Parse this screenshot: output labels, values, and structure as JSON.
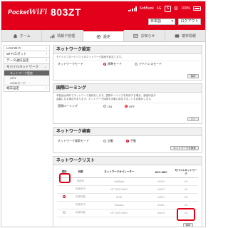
{
  "header": {
    "logo_text": "Pocket",
    "logo_wifi": "WiFi",
    "model": "803ZT",
    "carrier": "SoftBank",
    "network": "4G",
    "s_badge": "S",
    "battery": "100%",
    "language": "日本語",
    "logout": "ログアウト"
  },
  "nav": {
    "items": [
      {
        "label": "ホーム",
        "icon": "home-icon"
      },
      {
        "label": "情報や管理",
        "icon": "data-icon"
      },
      {
        "label": "設定",
        "icon": "gear-icon"
      },
      {
        "label": "お知らせ",
        "icon": "mail-icon"
      },
      {
        "label": "端末情報",
        "icon": "device-icon"
      }
    ],
    "active_index": 2
  },
  "sidebar": {
    "items": [
      {
        "label": "LAN Wi-Fi"
      },
      {
        "label": "Wi-Fiスポット"
      },
      {
        "label": "データ通信設定"
      },
      {
        "label": "モバイルネットワーク"
      }
    ],
    "sub_items": [
      "ネットワーク設定",
      "APN",
      "USIMカード"
    ],
    "after": [
      {
        "label": "端末設定"
      }
    ]
  },
  "network_settings": {
    "title": "ネットワーク設定",
    "desc": "モバイルブロードバンドのネットワーク接続を設定します。",
    "row_label": "ネットワークモード",
    "opt1": "標準モード",
    "opt2": "アドバンスモード",
    "save": "保存"
  },
  "roaming": {
    "title": "国際ローミング",
    "desc1": "本製品は海外でネットワーク接続をします。国際ローミングを利用する場合、通信料金が",
    "desc2": "高額になる場合があります。ネットワーク接続を手動に設定することをお勧めします。",
    "row_label": "国際ローミング",
    "opt_on": "ON",
    "opt_off": "OFF",
    "save": "保存"
  },
  "network_search": {
    "title": "ネットワーク検索",
    "row_label": "ネットワーク検索モード",
    "opt_auto": "自動",
    "opt_manual": "手動",
    "search_button": "ネットワークを検索"
  },
  "network_list": {
    "title": "ネットワークリスト",
    "headers": [
      "選択",
      "状態",
      "ネットワークオペレーター",
      "MCC-MNC",
      "モバイルネットワーク"
    ],
    "rows": [
      {
        "status": "利用中",
        "operator": "SoftBank",
        "mcc": "44020",
        "type": "4G"
      },
      {
        "status": "利用不可",
        "operator": "NTT DOCOMO",
        "mcc": "44010",
        "type": "4G"
      },
      {
        "status": "利用可能",
        "operator": "KDDI",
        "mcc": "44051",
        "type": "4G"
      },
      {
        "status": "利用不可",
        "operator": "Rakuten",
        "mcc": "44011",
        "type": "4G"
      },
      {
        "status": "利用可能",
        "operator": "NTT DOCOMO",
        "mcc": "44010",
        "type": "4G"
      }
    ],
    "save": "保存"
  }
}
